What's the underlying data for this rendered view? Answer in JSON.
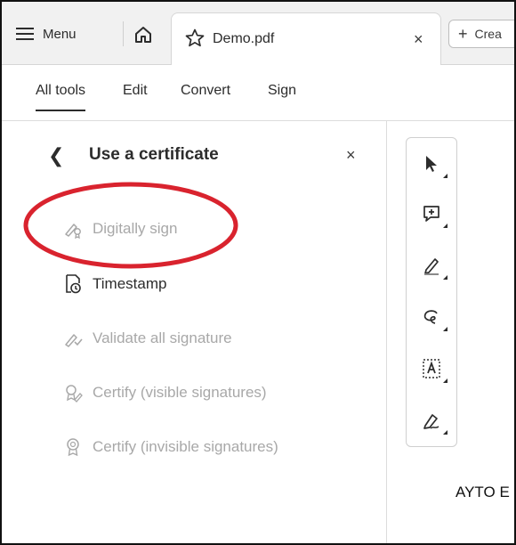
{
  "tabbar": {
    "menu_label": "Menu",
    "tab_name": "Demo.pdf",
    "close_glyph": "×",
    "create_label": "Crea"
  },
  "toolbar": {
    "tabs": [
      {
        "label": "All tools",
        "active": true
      },
      {
        "label": "Edit",
        "active": false
      },
      {
        "label": "Convert",
        "active": false
      },
      {
        "label": "Sign",
        "active": false
      }
    ]
  },
  "panel": {
    "title": "Use a certificate",
    "back_glyph": "❮",
    "close_glyph": "×",
    "items": [
      {
        "label": "Digitally sign",
        "icon": "digital-sign-icon",
        "enabled": false
      },
      {
        "label": "Timestamp",
        "icon": "timestamp-icon",
        "enabled": true
      },
      {
        "label": "Validate all signature",
        "icon": "validate-signature-icon",
        "enabled": false
      },
      {
        "label": "Certify (visible signatures)",
        "icon": "certify-visible-icon",
        "enabled": false
      },
      {
        "label": "Certify (invisible signatures)",
        "icon": "certify-invisible-icon",
        "enabled": false
      }
    ]
  },
  "quick_tools": [
    "select-cursor-icon",
    "add-comment-icon",
    "highlight-pen-icon",
    "draw-freeform-icon",
    "text-recognition-icon",
    "fill-sign-icon"
  ],
  "document": {
    "visible_text": "AYTO E"
  },
  "colors": {
    "annotation_ring": "#d9232e",
    "disabled_text": "#a8a8a8",
    "text": "#2c2c2c"
  }
}
